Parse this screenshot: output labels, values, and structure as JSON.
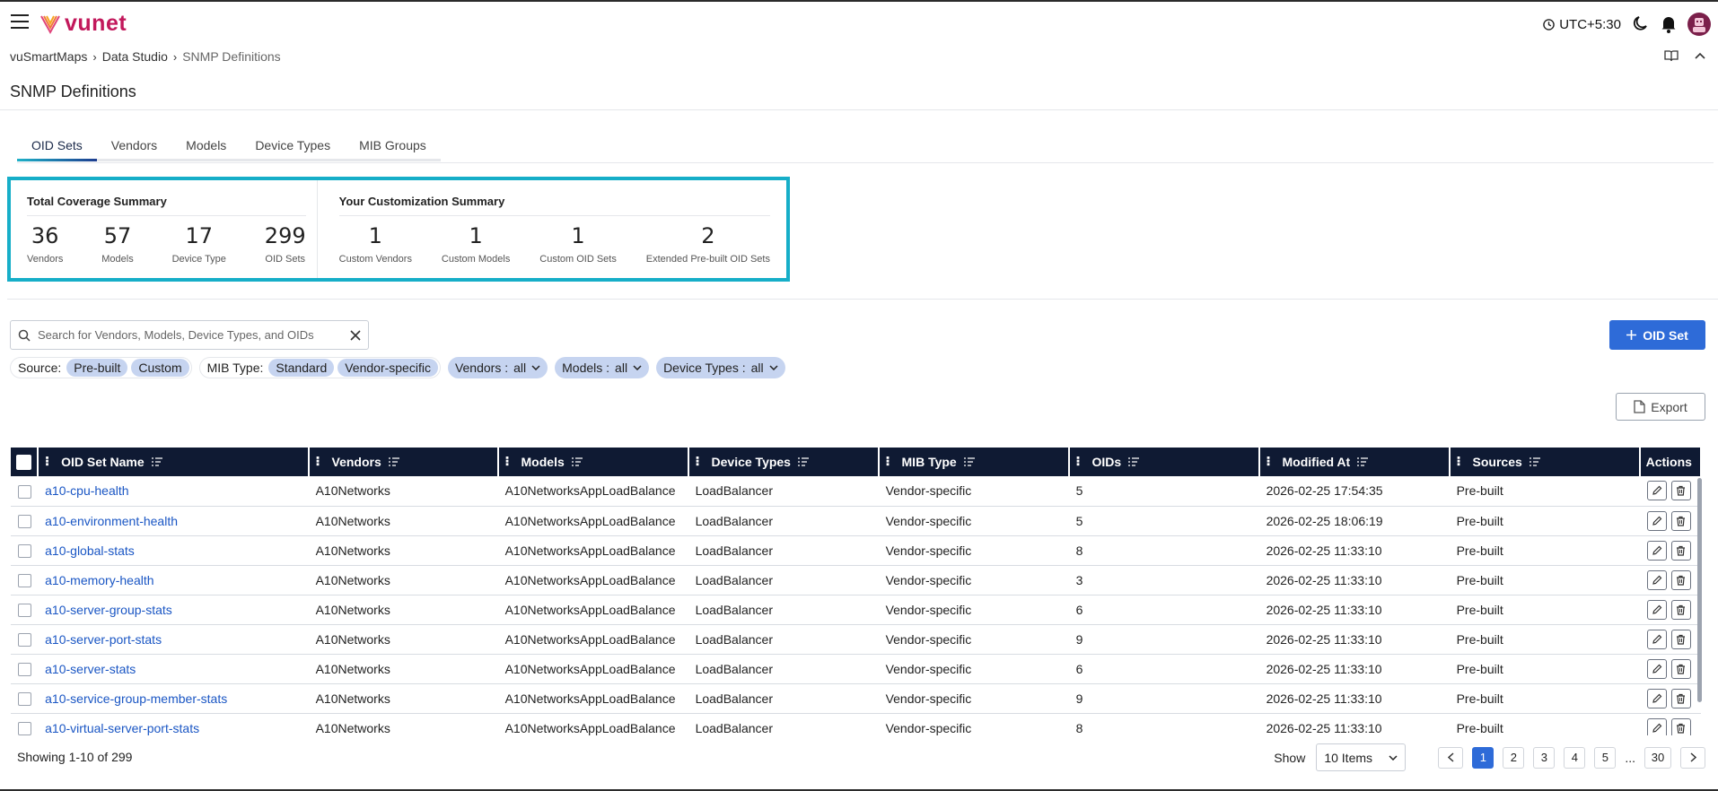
{
  "app": {
    "logo_text": "vunet",
    "timezone": "UTC+5:30",
    "brand_color": "#c2185b",
    "accent_color": "#2e6bd8",
    "highlight_color": "#16aec8"
  },
  "breadcrumb": [
    "vuSmartMaps",
    "Data Studio",
    "SNMP Definitions"
  ],
  "page_title": "SNMP Definitions",
  "tabs": [
    {
      "label": "OID Sets",
      "active": true
    },
    {
      "label": "Vendors",
      "active": false
    },
    {
      "label": "Models",
      "active": false
    },
    {
      "label": "Device Types",
      "active": false
    },
    {
      "label": "MIB Groups",
      "active": false
    }
  ],
  "coverage": {
    "title": "Total Coverage Summary",
    "stats": [
      {
        "value": "36",
        "label": "Vendors"
      },
      {
        "value": "57",
        "label": "Models"
      },
      {
        "value": "17",
        "label": "Device Type"
      },
      {
        "value": "299",
        "label": "OID Sets"
      }
    ]
  },
  "customization": {
    "title": "Your Customization Summary",
    "stats": [
      {
        "value": "1",
        "label": "Custom Vendors"
      },
      {
        "value": "1",
        "label": "Custom Models"
      },
      {
        "value": "1",
        "label": "Custom OID Sets"
      },
      {
        "value": "2",
        "label": "Extended Pre-built OID Sets"
      }
    ]
  },
  "search": {
    "placeholder": "Search for Vendors, Models, Device Types, and OIDs",
    "value": ""
  },
  "add_button": "OID Set",
  "filters": {
    "source_label": "Source:",
    "source_chips": [
      "Pre-built",
      "Custom"
    ],
    "mib_label": "MIB Type:",
    "mib_chips": [
      "Standard",
      "Vendor-specific"
    ],
    "vendors": {
      "label": "Vendors :",
      "value": "all"
    },
    "models": {
      "label": "Models :",
      "value": "all"
    },
    "device_types": {
      "label": "Device Types :",
      "value": "all"
    }
  },
  "export_button": "Export",
  "table": {
    "columns": [
      "OID Set Name",
      "Vendors",
      "Models",
      "Device Types",
      "MIB Type",
      "OIDs",
      "Modified At",
      "Sources",
      "Actions"
    ],
    "rows": [
      {
        "name": "a10-cpu-health",
        "vendor": "A10Networks",
        "model": "A10NetworksAppLoadBalance",
        "device_type": "LoadBalancer",
        "mib_type": "Vendor-specific",
        "oids": "5",
        "modified": "2026-02-25 17:54:35",
        "source": "Pre-built"
      },
      {
        "name": "a10-environment-health",
        "vendor": "A10Networks",
        "model": "A10NetworksAppLoadBalance",
        "device_type": "LoadBalancer",
        "mib_type": "Vendor-specific",
        "oids": "5",
        "modified": "2026-02-25 18:06:19",
        "source": "Pre-built"
      },
      {
        "name": "a10-global-stats",
        "vendor": "A10Networks",
        "model": "A10NetworksAppLoadBalance",
        "device_type": "LoadBalancer",
        "mib_type": "Vendor-specific",
        "oids": "8",
        "modified": "2026-02-25 11:33:10",
        "source": "Pre-built"
      },
      {
        "name": "a10-memory-health",
        "vendor": "A10Networks",
        "model": "A10NetworksAppLoadBalance",
        "device_type": "LoadBalancer",
        "mib_type": "Vendor-specific",
        "oids": "3",
        "modified": "2026-02-25 11:33:10",
        "source": "Pre-built"
      },
      {
        "name": "a10-server-group-stats",
        "vendor": "A10Networks",
        "model": "A10NetworksAppLoadBalance",
        "device_type": "LoadBalancer",
        "mib_type": "Vendor-specific",
        "oids": "6",
        "modified": "2026-02-25 11:33:10",
        "source": "Pre-built"
      },
      {
        "name": "a10-server-port-stats",
        "vendor": "A10Networks",
        "model": "A10NetworksAppLoadBalance",
        "device_type": "LoadBalancer",
        "mib_type": "Vendor-specific",
        "oids": "9",
        "modified": "2026-02-25 11:33:10",
        "source": "Pre-built"
      },
      {
        "name": "a10-server-stats",
        "vendor": "A10Networks",
        "model": "A10NetworksAppLoadBalance",
        "device_type": "LoadBalancer",
        "mib_type": "Vendor-specific",
        "oids": "6",
        "modified": "2026-02-25 11:33:10",
        "source": "Pre-built"
      },
      {
        "name": "a10-service-group-member-stats",
        "vendor": "A10Networks",
        "model": "A10NetworksAppLoadBalance",
        "device_type": "LoadBalancer",
        "mib_type": "Vendor-specific",
        "oids": "9",
        "modified": "2026-02-25 11:33:10",
        "source": "Pre-built"
      },
      {
        "name": "a10-virtual-server-port-stats",
        "vendor": "A10Networks",
        "model": "A10NetworksAppLoadBalance",
        "device_type": "LoadBalancer",
        "mib_type": "Vendor-specific",
        "oids": "8",
        "modified": "2026-02-25 11:33:10",
        "source": "Pre-built"
      }
    ]
  },
  "footer": {
    "showing": "Showing 1-10 of 299",
    "show_label": "Show",
    "page_size": "10 Items",
    "pages": [
      "1",
      "2",
      "3",
      "4",
      "5"
    ],
    "ellipsis": "...",
    "last_page": "30",
    "current_page": "1"
  }
}
